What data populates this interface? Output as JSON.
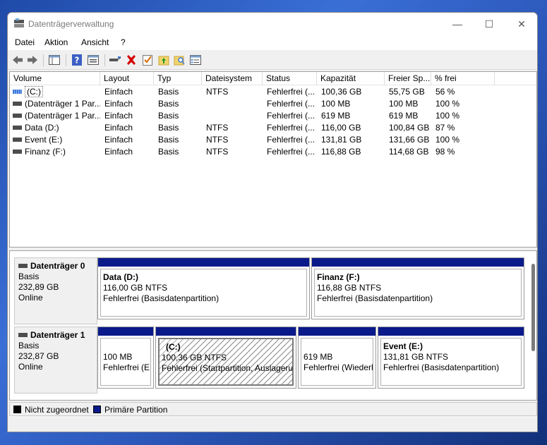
{
  "window": {
    "title": "Datenträgerverwaltung",
    "minimize": "—",
    "maximize": "☐",
    "close": "✕"
  },
  "menu": [
    "Datei",
    "Aktion",
    "Ansicht",
    "?"
  ],
  "toolbar": {
    "icons": [
      "back-arrow-icon",
      "forward-arrow-icon",
      "console-tree-icon",
      "help-icon",
      "properties-icon",
      "connect-icon",
      "delete-icon",
      "checklist-icon",
      "folder-up-icon",
      "folder-search-icon",
      "view-list-icon"
    ],
    "delete_color": "#d40000"
  },
  "columns": [
    "Volume",
    "Layout",
    "Typ",
    "Dateisystem",
    "Status",
    "Kapazität",
    "Freier Sp...",
    "% frei"
  ],
  "volumes": [
    {
      "name": "(C:)",
      "layout": "Einfach",
      "typ": "Basis",
      "fs": "NTFS",
      "status": "Fehlerfrei (...",
      "cap": "100,36 GB",
      "free": "55,75 GB",
      "pct": "56 %"
    },
    {
      "name": "(Datenträger 1 Par...",
      "layout": "Einfach",
      "typ": "Basis",
      "fs": "",
      "status": "Fehlerfrei (...",
      "cap": "100 MB",
      "free": "100 MB",
      "pct": "100 %"
    },
    {
      "name": "(Datenträger 1 Par...",
      "layout": "Einfach",
      "typ": "Basis",
      "fs": "",
      "status": "Fehlerfrei (...",
      "cap": "619 MB",
      "free": "619 MB",
      "pct": "100 %"
    },
    {
      "name": "Data (D:)",
      "layout": "Einfach",
      "typ": "Basis",
      "fs": "NTFS",
      "status": "Fehlerfrei (...",
      "cap": "116,00 GB",
      "free": "100,84 GB",
      "pct": "87 %"
    },
    {
      "name": "Event (E:)",
      "layout": "Einfach",
      "typ": "Basis",
      "fs": "NTFS",
      "status": "Fehlerfrei (...",
      "cap": "131,81 GB",
      "free": "131,66 GB",
      "pct": "100 %"
    },
    {
      "name": "Finanz (F:)",
      "layout": "Einfach",
      "typ": "Basis",
      "fs": "NTFS",
      "status": "Fehlerfrei (...",
      "cap": "116,88 GB",
      "free": "114,68 GB",
      "pct": "98 %"
    }
  ],
  "disks": [
    {
      "name": "Datenträger 0",
      "type": "Basis",
      "size": "232,89 GB",
      "state": "Online",
      "partitions": [
        {
          "name": "Data  (D:)",
          "size": "116,00 GB NTFS",
          "status": "Fehlerfrei (Basisdatenpartition)"
        },
        {
          "name": "Finanz  (F:)",
          "size": "116,88 GB NTFS",
          "status": "Fehlerfrei (Basisdatenpartition)"
        }
      ]
    },
    {
      "name": "Datenträger 1",
      "type": "Basis",
      "size": "232,87 GB",
      "state": "Online",
      "partitions": [
        {
          "name": "",
          "size": "100 MB",
          "status": "Fehlerfrei (EF"
        },
        {
          "name": "(C:)",
          "size": "100,36 GB NTFS",
          "status": "Fehlerfrei (Startpartition, Auslagerur"
        },
        {
          "name": "",
          "size": "619 MB",
          "status": "Fehlerfrei (Wiederh"
        },
        {
          "name": "Event  (E:)",
          "size": "131,81 GB NTFS",
          "status": "Fehlerfrei (Basisdatenpartition)"
        }
      ]
    }
  ],
  "legend": [
    {
      "label": "Nicht zugeordnet",
      "color": "#000000"
    },
    {
      "label": "Primäre Partition",
      "color": "#0a1a8a"
    }
  ]
}
